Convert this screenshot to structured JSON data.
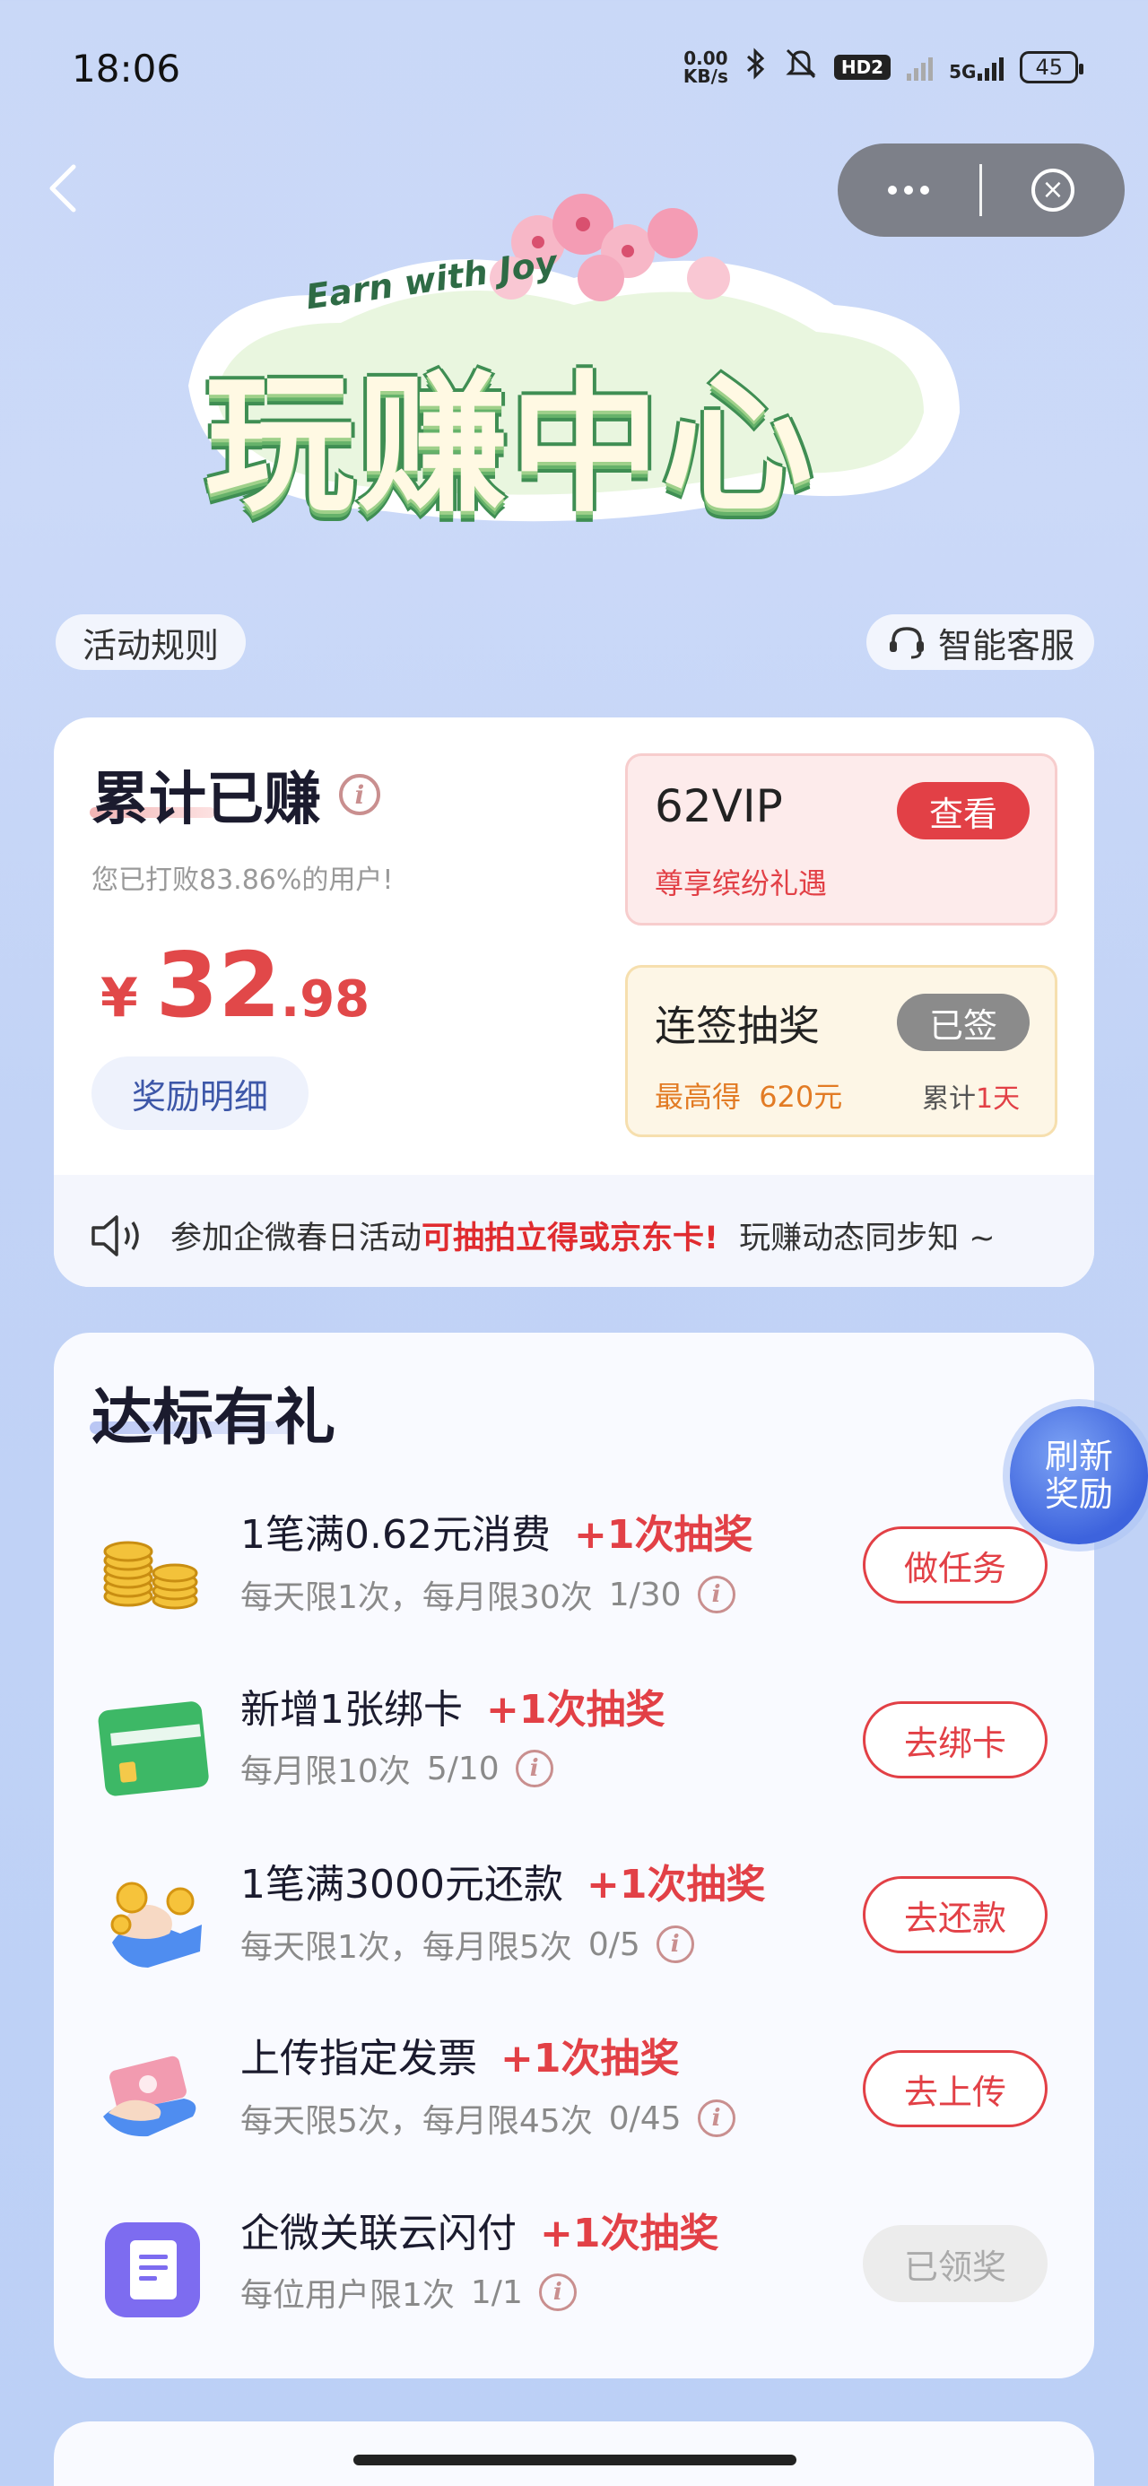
{
  "status_bar": {
    "time": "18:06",
    "net_speed_value": "0.00",
    "net_speed_unit": "KB/s",
    "hd_label": "HD2",
    "network": "5G",
    "battery": "45"
  },
  "nav": {
    "back_icon": "chevron-left-icon",
    "more_icon": "more-dots-icon",
    "close_icon": "close-circle-icon"
  },
  "banner": {
    "subtitle": "Earn with Joy",
    "title": "玩赚中心"
  },
  "top_links": {
    "rules": "活动规则",
    "service": "智能客服"
  },
  "earnings": {
    "title": "累计已赚",
    "subtitle": "您已打败83.86%的用户!",
    "currency": "¥",
    "amount_int": "32",
    "amount_dec": ".98",
    "detail_button": "奖励明细"
  },
  "vip": {
    "name": "62VIP",
    "button": "查看",
    "subtitle": "尊享缤纷礼遇"
  },
  "sign_in": {
    "title": "连签抽奖",
    "button": "已签",
    "max_prefix": "最高得",
    "max_value": "620元",
    "count_prefix": "累计",
    "count_value": "1天"
  },
  "notice": {
    "part1": "参加企微春日活动",
    "highlight": "可抽拍立得或京东卡!",
    "part2": "玩赚动态同步知 ~"
  },
  "tasks": {
    "title": "达标有礼",
    "refresh": "刷新奖励",
    "items": [
      {
        "name": "1笔满0.62元消费",
        "reward": "+1次抽奖",
        "desc": "每天限1次，每月限30次",
        "progress": "1/30",
        "button": "做任务",
        "done": false
      },
      {
        "name": "新增1张绑卡",
        "reward": "+1次抽奖",
        "desc": "每月限10次",
        "progress": "5/10",
        "button": "去绑卡",
        "done": false
      },
      {
        "name": "1笔满3000元还款",
        "reward": "+1次抽奖",
        "desc": "每天限1次，每月限5次",
        "progress": "0/5",
        "button": "去还款",
        "done": false
      },
      {
        "name": "上传指定发票",
        "reward": "+1次抽奖",
        "desc": "每天限5次，每月限45次",
        "progress": "0/45",
        "button": "去上传",
        "done": false
      },
      {
        "name": "企微关联云闪付",
        "reward": "+1次抽奖",
        "desc": "每位用户限1次",
        "progress": "1/1",
        "button": "已领奖",
        "done": true
      }
    ]
  },
  "colors": {
    "accent_red": "#e24046",
    "highlight_red": "#e02b2f",
    "sign_orange": "#e27b24",
    "link_blue": "#3d57a8"
  }
}
